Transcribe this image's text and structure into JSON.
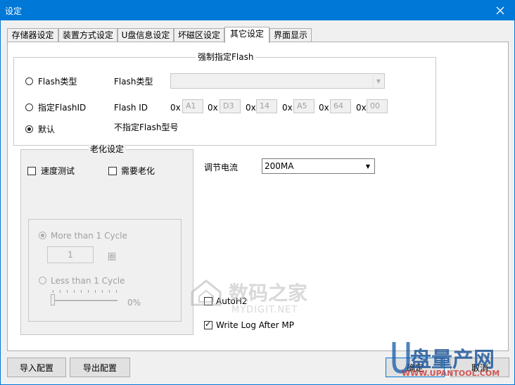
{
  "window": {
    "title": "设定"
  },
  "tabs": [
    {
      "label": "存储器设定"
    },
    {
      "label": "装置方式设定"
    },
    {
      "label": "U盘信息设定"
    },
    {
      "label": "坏磁区设定"
    },
    {
      "label": "其它设定",
      "active": true
    },
    {
      "label": "界面显示"
    }
  ],
  "flash_group": {
    "title": "强制指定Flash",
    "opt_type_label": "Flash类型",
    "type_label": "Flash类型",
    "type_value": "",
    "opt_id_label": "指定FlashID",
    "id_label": "Flash  ID",
    "id_prefix": "0x",
    "id_bytes": [
      "A1",
      "D3",
      "14",
      "A5",
      "64",
      "00"
    ],
    "opt_default_label": "默认",
    "default_desc": "不指定Flash型号",
    "selected": "default"
  },
  "aging_group": {
    "title": "老化设定",
    "speed_test_label": "速度测试",
    "speed_test_checked": false,
    "need_aging_label": "需要老化",
    "need_aging_checked": false,
    "more_than_label": "More than 1 Cycle",
    "more_than_checked": true,
    "cycles_value": "1",
    "cycles_unit": "圈",
    "less_than_label": "Less than 1 Cycle",
    "less_than_checked": false,
    "percent_label": "0%",
    "percent_value": 0
  },
  "current": {
    "label": "调节电流",
    "value": "200MA"
  },
  "options": {
    "autoh2_label": "AutoH2",
    "autoh2_checked": false,
    "write_log_label": "Write Log After MP",
    "write_log_checked": true
  },
  "buttons": {
    "import_label": "导入配置",
    "export_label": "导出配置",
    "ok_label": "确定",
    "cancel_label": "取消"
  },
  "watermarks": {
    "left_brand": "数码之家",
    "left_domain": "MYDIGIT.NET",
    "right_brand": "盘量产网",
    "right_domain": "WWW.UPANTOOL.COM"
  },
  "colors": {
    "accent": "#0078d7",
    "panel": "#ffffff",
    "window_bg": "#f0f0f0"
  }
}
